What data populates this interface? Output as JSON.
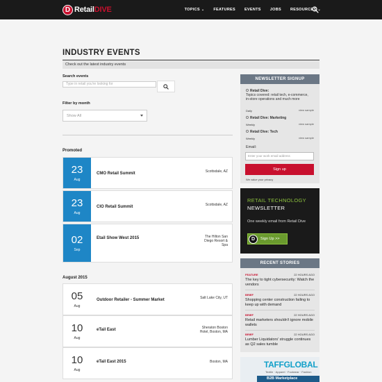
{
  "header": {
    "logo_text": "Retail",
    "logo_text_accent": "DIVE",
    "logo_mark": "D",
    "nav": [
      {
        "label": "TOPICS",
        "has_dropdown": true
      },
      {
        "label": "FEATURES",
        "has_dropdown": false
      },
      {
        "label": "EVENTS",
        "has_dropdown": false
      },
      {
        "label": "JOBS",
        "has_dropdown": false
      },
      {
        "label": "RESOURCES",
        "has_dropdown": true
      }
    ],
    "search_icon": "search-icon"
  },
  "main": {
    "title": "INDUSTRY EVENTS",
    "subtitle": "Check out the latest industry events",
    "search_label": "Search events",
    "search_placeholder": "Type in retail you're looking for",
    "filter_label": "Filter by month",
    "filter_value": "Show All",
    "promoted_label": "Promoted",
    "promoted": [
      {
        "day": "23",
        "month": "Aug",
        "name": "CMO Retail Summit",
        "location": "Scottsdale, AZ"
      },
      {
        "day": "23",
        "month": "Aug",
        "name": "CIO Retail Summit",
        "location": "Scottsdale, AZ"
      },
      {
        "day": "02",
        "month": "Sep",
        "name": "Etail Show West 2015",
        "location": "The Hilton San Diego Resort & Spa"
      }
    ],
    "month_label": "August 2015",
    "events": [
      {
        "day": "05",
        "month": "Aug",
        "name": "Outdoor Retailer - Summer Market",
        "location": "Salt Lake City, UT"
      },
      {
        "day": "10",
        "month": "Aug",
        "name": "eTail East",
        "location": "Sheraton Boston Hotel, Boston, MA"
      },
      {
        "day": "10",
        "month": "Aug",
        "name": "eTail East 2015",
        "location": "Boston, MA"
      }
    ]
  },
  "newsletter": {
    "heading": "NEWSLETTER SIGNUP",
    "options": [
      {
        "name": "Retail Dive:",
        "desc": "Topics covered: retail tech, e-commerce, in-store operations and much more",
        "freq": "Daily",
        "sample": "view sample",
        "checked": true
      },
      {
        "name": "Retail Dive: Marketing",
        "desc": "",
        "freq": "Weekly",
        "sample": "view sample",
        "checked": false
      },
      {
        "name": "Retail Dive: Tech",
        "desc": "",
        "freq": "Weekly",
        "sample": "view sample",
        "checked": false
      }
    ],
    "email_label": "Email:",
    "email_placeholder": "Enter your work email address",
    "button": "Sign up",
    "privacy": "We value your privacy"
  },
  "ad": {
    "line1": "RETAIL TECHNOLOGY",
    "line2": "NEWSLETTER",
    "text": "One weekly email from Retail Dive",
    "button": "Sign Up >>",
    "logo_mark": "D"
  },
  "recent": {
    "heading": "RECENT STORIES",
    "stories": [
      {
        "type": "FEATURE",
        "ago": "22 HOURS AGO",
        "title": "The key to tight cybersecurity: Watch the vendors"
      },
      {
        "type": "BRIEF",
        "ago": "22 HOURS AGO",
        "title": "Shopping center construction failing to keep up with demand"
      },
      {
        "type": "BRIEF",
        "ago": "22 HOURS AGO",
        "title": "Retail marketers shouldn't ignore mobile wallets"
      },
      {
        "type": "BRIEF",
        "ago": "22 HOURS AGO",
        "title": "Lumber Liquidators' struggle continues as Q2 sales tumble"
      }
    ]
  },
  "ad2": {
    "title": "TAFFGLOBAL",
    "sub": "Textile · Apparel · Footwear · Fashion",
    "bar": "B2B Marketplace"
  },
  "colors": {
    "accent": "#c8102e",
    "promo_blue": "#1e86c6",
    "sidebar_head": "#6b7785",
    "ad_green": "#8fc43f"
  }
}
